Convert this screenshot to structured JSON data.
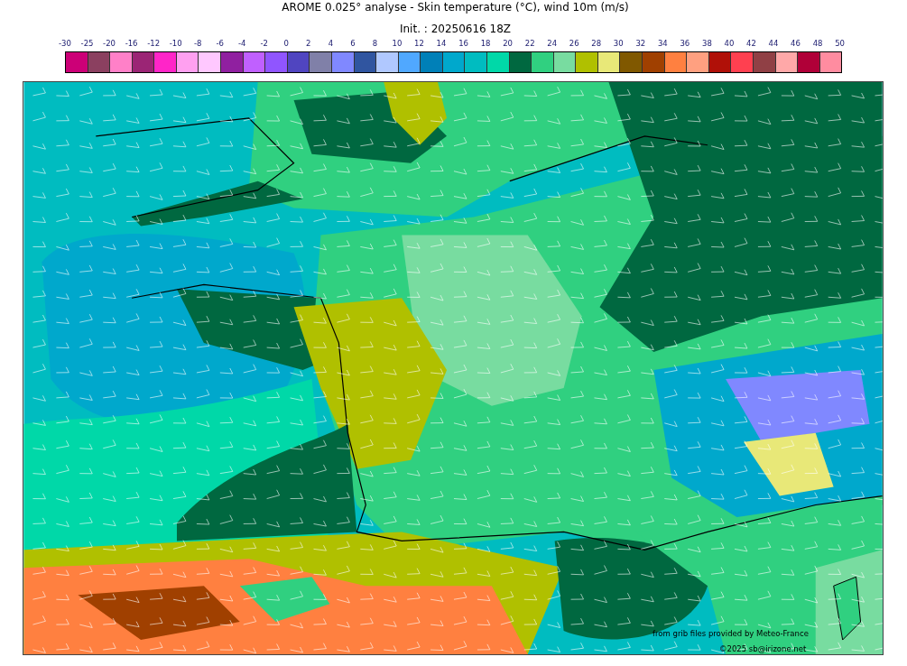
{
  "title": "AROME 0.025° analyse - Skin temperature (°C), wind 10m (m/s)",
  "subtitle": "Init. : 20250616 18Z",
  "colorbar": {
    "ticks": [
      "-30",
      "-25",
      "-20",
      "-16",
      "-12",
      "-10",
      "-8",
      "-6",
      "-4",
      "-2",
      "0",
      "2",
      "4",
      "6",
      "8",
      "10",
      "12",
      "14",
      "16",
      "18",
      "20",
      "22",
      "24",
      "26",
      "28",
      "30",
      "32",
      "34",
      "36",
      "38",
      "40",
      "42",
      "44",
      "46",
      "48",
      "50"
    ],
    "bins": [
      {
        "color": "#cc0077"
      },
      {
        "color": "#8b4060"
      },
      {
        "color": "#ff80c8"
      },
      {
        "color": "#9b2575"
      },
      {
        "color": "#ff25c8"
      },
      {
        "color": "#ffa0f0"
      },
      {
        "color": "#ffc8ff"
      },
      {
        "color": "#9020a0"
      },
      {
        "color": "#c060ff"
      },
      {
        "color": "#9055ff"
      },
      {
        "color": "#5045c0"
      },
      {
        "color": "#8080a8"
      },
      {
        "color": "#8088ff"
      },
      {
        "color": "#3055a0"
      },
      {
        "color": "#b0c8ff"
      },
      {
        "color": "#50a8ff"
      },
      {
        "color": "#0080b8"
      },
      {
        "color": "#00a8cc"
      },
      {
        "color": "#00bcc0"
      },
      {
        "color": "#00d8a8"
      },
      {
        "color": "#006840"
      },
      {
        "color": "#30d080"
      },
      {
        "color": "#78dca0"
      },
      {
        "color": "#b0c000"
      },
      {
        "color": "#e8e878"
      },
      {
        "color": "#805800"
      },
      {
        "color": "#a04000"
      },
      {
        "color": "#ff8040"
      },
      {
        "color": "#ffa080"
      },
      {
        "color": "#b01008"
      },
      {
        "color": "#ff4050"
      },
      {
        "color": "#904045"
      },
      {
        "color": "#ffa8a8"
      },
      {
        "color": "#b00038"
      },
      {
        "color": "#ff8ca0"
      }
    ]
  },
  "map": {
    "credits": [
      "from grib files provided by Meteo-France",
      "©2025 sb@irizone.net"
    ]
  }
}
